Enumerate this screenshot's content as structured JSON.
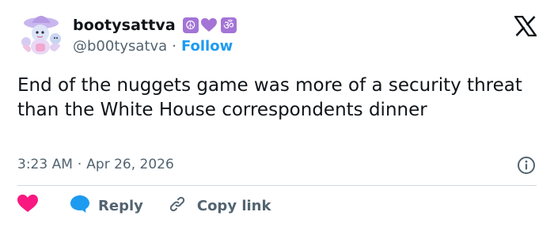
{
  "author": {
    "display_name": "bootysattva",
    "badges": [
      "☮",
      "heart-purple",
      "ॐ"
    ],
    "handle": "@b00tysatva",
    "separator": "·",
    "follow_label": "Follow"
  },
  "tweet": {
    "text": "End of the nuggets game was more of a security threat than the White House correspondents dinner",
    "time": "3:23 AM",
    "date_separator": "·",
    "date": "Apr 26, 2026"
  },
  "actions": {
    "reply_label": "Reply",
    "copy_link_label": "Copy link"
  },
  "icons": {
    "logo": "x-logo-icon",
    "info": "info-icon",
    "like": "heart-icon",
    "reply": "speech-bubble-icon",
    "copy": "link-icon"
  },
  "colors": {
    "text": "#0f1419",
    "secondary": "#536471",
    "follow": "#1d9bf0",
    "heart": "#f91880",
    "reply_bubble": "#1d9bf0",
    "badge_purple": "#a374d6",
    "divider": "#cfd9de"
  }
}
